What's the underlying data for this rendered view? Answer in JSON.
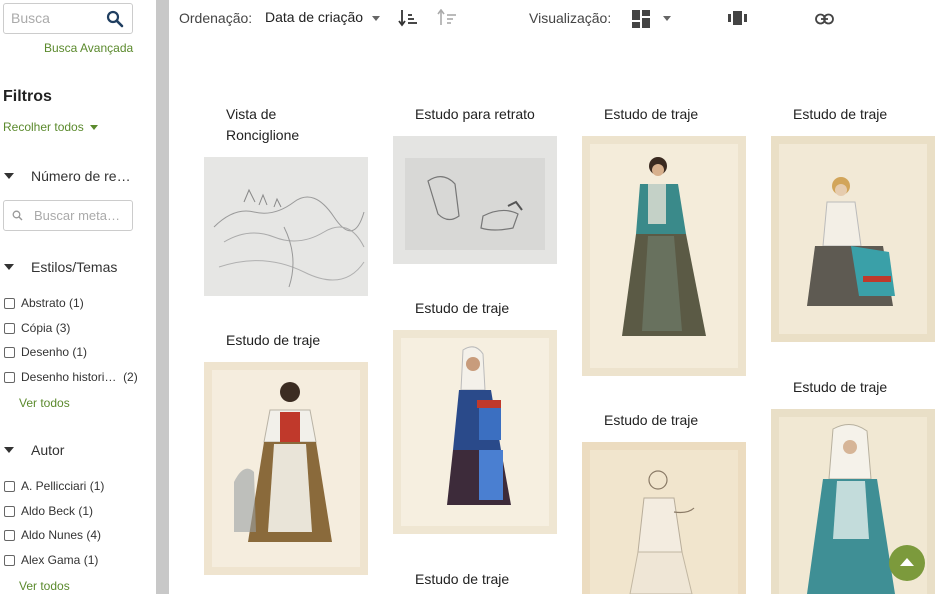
{
  "search": {
    "placeholder": "Busca",
    "advanced_label": "Busca Avançada"
  },
  "filters": {
    "title": "Filtros",
    "collapse_label": "Recolher todos",
    "facets": [
      {
        "label": "Número de re…",
        "search_placeholder": "Buscar meta…"
      },
      {
        "label": "Estilos/Temas",
        "items": [
          {
            "label": "Abstrato",
            "count": "(1)"
          },
          {
            "label": "Cópia",
            "count": "(3)"
          },
          {
            "label": "Desenho",
            "count": "(1)"
          },
          {
            "label": "Desenho histori…",
            "count": "(2)"
          }
        ],
        "see_all": "Ver todos"
      },
      {
        "label": "Autor",
        "items": [
          {
            "label": "A. Pellicciari",
            "count": "(1)"
          },
          {
            "label": "Aldo Beck",
            "count": "(1)"
          },
          {
            "label": "Aldo Nunes",
            "count": "(4)"
          },
          {
            "label": "Alex Gama",
            "count": "(1)"
          }
        ],
        "see_all": "Ver todos"
      }
    ]
  },
  "toolbar": {
    "sort_label": "Ordenação:",
    "sort_value": "Data de criação",
    "view_label": "Visualização:"
  },
  "gallery": {
    "items": [
      {
        "title_line1": "Vista de",
        "title_line2": "Ronciglione"
      },
      {
        "title": "Estudo para retrato"
      },
      {
        "title": "Estudo de traje"
      },
      {
        "title": "Estudo de traje"
      },
      {
        "title": "Estudo de traje"
      },
      {
        "title": "Estudo de traje"
      },
      {
        "title": "Estudo de traje"
      },
      {
        "title": "Estudo de traje"
      },
      {
        "title": "Estudo de traje"
      }
    ]
  },
  "icons": [
    "search-icon",
    "sort-descending-icon",
    "sort-ascending-icon",
    "masonry-view-icon",
    "slideshow-view-icon",
    "link-icon",
    "scroll-top-icon"
  ],
  "colors": {
    "accent": "#5b8a2d",
    "scroll_top": "#7c9a3c"
  }
}
